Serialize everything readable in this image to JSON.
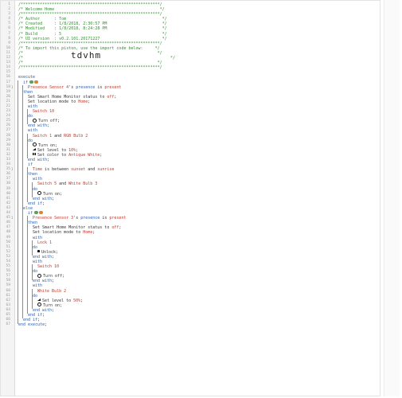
{
  "header_block": {
    "lines": [
      {
        "n": "1",
        "text": "/**********************************************************/"
      },
      {
        "n": "2",
        "text": "/* Welcome Home                                            */"
      },
      {
        "n": "3",
        "text": "/**********************************************************/"
      },
      {
        "n": "4",
        "text": "/* Author      : Tom                                        */"
      },
      {
        "n": "5",
        "text": "/* Created     : 1/8/2018, 2:30:57 PM                       */"
      },
      {
        "n": "6",
        "text": "/* Modified    : 1/8/2018, 8:24:28 PM                       */"
      },
      {
        "n": "7",
        "text": "/* Build       : 5                                          */"
      },
      {
        "n": "8",
        "text": "/* UI version  : v0.2.101.20171227                          */"
      },
      {
        "n": "9",
        "text": "/**********************************************************/"
      },
      {
        "n": "10",
        "text": "/* To import this piston, use the import code below:     */"
      },
      {
        "n": "11",
        "text": "/*                                                        */"
      },
      {
        "n": "12",
        "text": "/*"
      },
      {
        "n": "13",
        "text": "/*                                                        */"
      },
      {
        "n": "14",
        "text": "/**********************************************************/"
      }
    ],
    "import_code": "tdvhm",
    "import_code_suffix": "*/"
  },
  "code_lines": [
    {
      "n": "15",
      "indent": 0,
      "parts": []
    },
    {
      "n": "16",
      "indent": 0,
      "parts": [
        {
          "c": "kw",
          "t": "execute"
        }
      ]
    },
    {
      "n": "17",
      "indent": 1,
      "pills": true,
      "parts": [
        {
          "c": "kw",
          "t": "if"
        }
      ]
    },
    {
      "n": "18",
      "mark": "1",
      "indent": 2,
      "parts": [
        {
          "c": "dev",
          "t": "Presence Sensor 4"
        },
        {
          "c": "",
          "t": "'s "
        },
        {
          "c": "kw",
          "t": "presence"
        },
        {
          "c": "",
          "t": " is "
        },
        {
          "c": "str",
          "t": "present"
        }
      ]
    },
    {
      "n": "19",
      "indent": 1,
      "parts": [
        {
          "c": "kw",
          "t": "then"
        }
      ]
    },
    {
      "n": "20",
      "indent": 2,
      "parts": [
        {
          "c": "",
          "t": "Set Smart Home Monitor status to "
        },
        {
          "c": "str",
          "t": "off"
        },
        {
          "c": "",
          "t": ";"
        }
      ]
    },
    {
      "n": "21",
      "indent": 2,
      "parts": [
        {
          "c": "",
          "t": "Set location mode to "
        },
        {
          "c": "str",
          "t": "Home"
        },
        {
          "c": "",
          "t": ";"
        }
      ]
    },
    {
      "n": "22",
      "indent": 2,
      "parts": [
        {
          "c": "kw",
          "t": "with"
        }
      ]
    },
    {
      "n": "23",
      "indent": 3,
      "parts": [
        {
          "c": "dev",
          "t": "Switch 10"
        }
      ]
    },
    {
      "n": "24",
      "indent": 2,
      "parts": [
        {
          "c": "kw",
          "t": "do"
        }
      ]
    },
    {
      "n": "25",
      "indent": 3,
      "icon": "power",
      "parts": [
        {
          "c": "",
          "t": "Turn off;"
        }
      ]
    },
    {
      "n": "26",
      "indent": 2,
      "parts": [
        {
          "c": "kw",
          "t": "end with"
        },
        {
          "c": "",
          "t": ";"
        }
      ]
    },
    {
      "n": "27",
      "indent": 2,
      "parts": [
        {
          "c": "kw",
          "t": "with"
        }
      ]
    },
    {
      "n": "28",
      "indent": 3,
      "parts": [
        {
          "c": "dev",
          "t": "Switch 1"
        },
        {
          "c": "",
          "t": " and "
        },
        {
          "c": "dev",
          "t": "RGB Bulb 2"
        }
      ]
    },
    {
      "n": "29",
      "indent": 2,
      "parts": [
        {
          "c": "kw",
          "t": "do"
        }
      ]
    },
    {
      "n": "30",
      "indent": 3,
      "icon": "power",
      "parts": [
        {
          "c": "",
          "t": "Turn on;"
        }
      ]
    },
    {
      "n": "31",
      "indent": 3,
      "icon": "level",
      "parts": [
        {
          "c": "",
          "t": "Set level to "
        },
        {
          "c": "str",
          "t": "10%"
        },
        {
          "c": "",
          "t": ";"
        }
      ]
    },
    {
      "n": "32",
      "indent": 3,
      "icon": "palette",
      "parts": [
        {
          "c": "",
          "t": "Set color to "
        },
        {
          "c": "str",
          "t": "Antique White"
        },
        {
          "c": "",
          "t": ";"
        }
      ]
    },
    {
      "n": "33",
      "indent": 2,
      "parts": [
        {
          "c": "kw",
          "t": "end with"
        },
        {
          "c": "",
          "t": ";"
        }
      ]
    },
    {
      "n": "34",
      "indent": 2,
      "parts": [
        {
          "c": "kw",
          "t": "if"
        }
      ]
    },
    {
      "n": "35",
      "mark": "1",
      "indent": 3,
      "parts": [
        {
          "c": "str",
          "t": "Time"
        },
        {
          "c": "",
          "t": " is between "
        },
        {
          "c": "str",
          "t": "sunset"
        },
        {
          "c": "",
          "t": " and "
        },
        {
          "c": "str",
          "t": "sunrise"
        }
      ]
    },
    {
      "n": "36",
      "indent": 2,
      "parts": [
        {
          "c": "kw",
          "t": "then"
        }
      ]
    },
    {
      "n": "37",
      "indent": 3,
      "parts": [
        {
          "c": "kw",
          "t": "with"
        }
      ]
    },
    {
      "n": "38",
      "indent": 4,
      "parts": [
        {
          "c": "dev",
          "t": "Switch 5"
        },
        {
          "c": "",
          "t": " and "
        },
        {
          "c": "dev",
          "t": "White Bulb 3"
        }
      ]
    },
    {
      "n": "39",
      "indent": 3,
      "parts": [
        {
          "c": "kw",
          "t": "do"
        }
      ]
    },
    {
      "n": "40",
      "indent": 4,
      "icon": "power",
      "parts": [
        {
          "c": "",
          "t": "Turn on;"
        }
      ]
    },
    {
      "n": "41",
      "indent": 3,
      "parts": [
        {
          "c": "kw",
          "t": "end with"
        },
        {
          "c": "",
          "t": ";"
        }
      ]
    },
    {
      "n": "42",
      "indent": 2,
      "parts": [
        {
          "c": "kw",
          "t": "end if"
        },
        {
          "c": "",
          "t": ";"
        }
      ]
    },
    {
      "n": "43",
      "indent": 1,
      "parts": [
        {
          "c": "kw",
          "t": "else"
        }
      ]
    },
    {
      "n": "44",
      "indent": 2,
      "pills": true,
      "parts": [
        {
          "c": "kw",
          "t": "if"
        }
      ]
    },
    {
      "n": "45",
      "mark": "1",
      "indent": 3,
      "parts": [
        {
          "c": "dev",
          "t": "Presence Sensor 3"
        },
        {
          "c": "",
          "t": "'s "
        },
        {
          "c": "kw",
          "t": "presence"
        },
        {
          "c": "",
          "t": " is "
        },
        {
          "c": "str",
          "t": "present"
        }
      ]
    },
    {
      "n": "46",
      "indent": 2,
      "parts": [
        {
          "c": "kw",
          "t": "then"
        }
      ]
    },
    {
      "n": "47",
      "indent": 3,
      "parts": [
        {
          "c": "",
          "t": "Set Smart Home Monitor status to "
        },
        {
          "c": "str",
          "t": "off"
        },
        {
          "c": "",
          "t": ";"
        }
      ]
    },
    {
      "n": "48",
      "indent": 3,
      "parts": [
        {
          "c": "",
          "t": "Set location mode to "
        },
        {
          "c": "str",
          "t": "Home"
        },
        {
          "c": "",
          "t": ";"
        }
      ]
    },
    {
      "n": "49",
      "indent": 3,
      "parts": [
        {
          "c": "kw",
          "t": "with"
        }
      ]
    },
    {
      "n": "50",
      "indent": 4,
      "parts": [
        {
          "c": "dev",
          "t": "Lock 1"
        }
      ]
    },
    {
      "n": "51",
      "indent": 3,
      "parts": [
        {
          "c": "kw",
          "t": "do"
        }
      ]
    },
    {
      "n": "52",
      "indent": 4,
      "icon": "lock",
      "parts": [
        {
          "c": "",
          "t": "Unlock;"
        }
      ]
    },
    {
      "n": "53",
      "indent": 3,
      "parts": [
        {
          "c": "kw",
          "t": "end with"
        },
        {
          "c": "",
          "t": ";"
        }
      ]
    },
    {
      "n": "54",
      "indent": 3,
      "parts": [
        {
          "c": "kw",
          "t": "with"
        }
      ]
    },
    {
      "n": "55",
      "indent": 4,
      "parts": [
        {
          "c": "dev",
          "t": "Switch 10"
        }
      ]
    },
    {
      "n": "56",
      "indent": 3,
      "parts": [
        {
          "c": "kw",
          "t": "do"
        }
      ]
    },
    {
      "n": "57",
      "indent": 4,
      "icon": "power",
      "parts": [
        {
          "c": "",
          "t": "Turn off;"
        }
      ]
    },
    {
      "n": "58",
      "indent": 3,
      "parts": [
        {
          "c": "kw",
          "t": "end with"
        },
        {
          "c": "",
          "t": ";"
        }
      ]
    },
    {
      "n": "59",
      "indent": 3,
      "parts": [
        {
          "c": "kw",
          "t": "with"
        }
      ]
    },
    {
      "n": "60",
      "indent": 4,
      "parts": [
        {
          "c": "dev",
          "t": "White Bulb 2"
        }
      ]
    },
    {
      "n": "61",
      "indent": 3,
      "parts": [
        {
          "c": "kw",
          "t": "do"
        }
      ]
    },
    {
      "n": "62",
      "indent": 4,
      "icon": "level",
      "parts": [
        {
          "c": "",
          "t": "Set level to "
        },
        {
          "c": "str",
          "t": "50%"
        },
        {
          "c": "",
          "t": ";"
        }
      ]
    },
    {
      "n": "63",
      "indent": 4,
      "icon": "power",
      "parts": [
        {
          "c": "",
          "t": "Turn on;"
        }
      ]
    },
    {
      "n": "64",
      "indent": 3,
      "parts": [
        {
          "c": "kw",
          "t": "end with"
        },
        {
          "c": "",
          "t": ";"
        }
      ]
    },
    {
      "n": "65",
      "indent": 2,
      "parts": [
        {
          "c": "kw",
          "t": "end if"
        },
        {
          "c": "",
          "t": ";"
        }
      ]
    },
    {
      "n": "66",
      "indent": 1,
      "parts": [
        {
          "c": "kw",
          "t": "end if"
        },
        {
          "c": "",
          "t": ";"
        }
      ]
    },
    {
      "n": "67",
      "indent": 0,
      "parts": [
        {
          "c": "kw",
          "t": "end execute"
        },
        {
          "c": "",
          "t": ";"
        }
      ]
    }
  ],
  "colors": {
    "comment": "#2f8f2f",
    "keyword": "#2a5db0",
    "device": "#c0392b",
    "value": "#c0392b",
    "pill_green": "#5aa25a",
    "pill_orange": "#d3863a"
  }
}
